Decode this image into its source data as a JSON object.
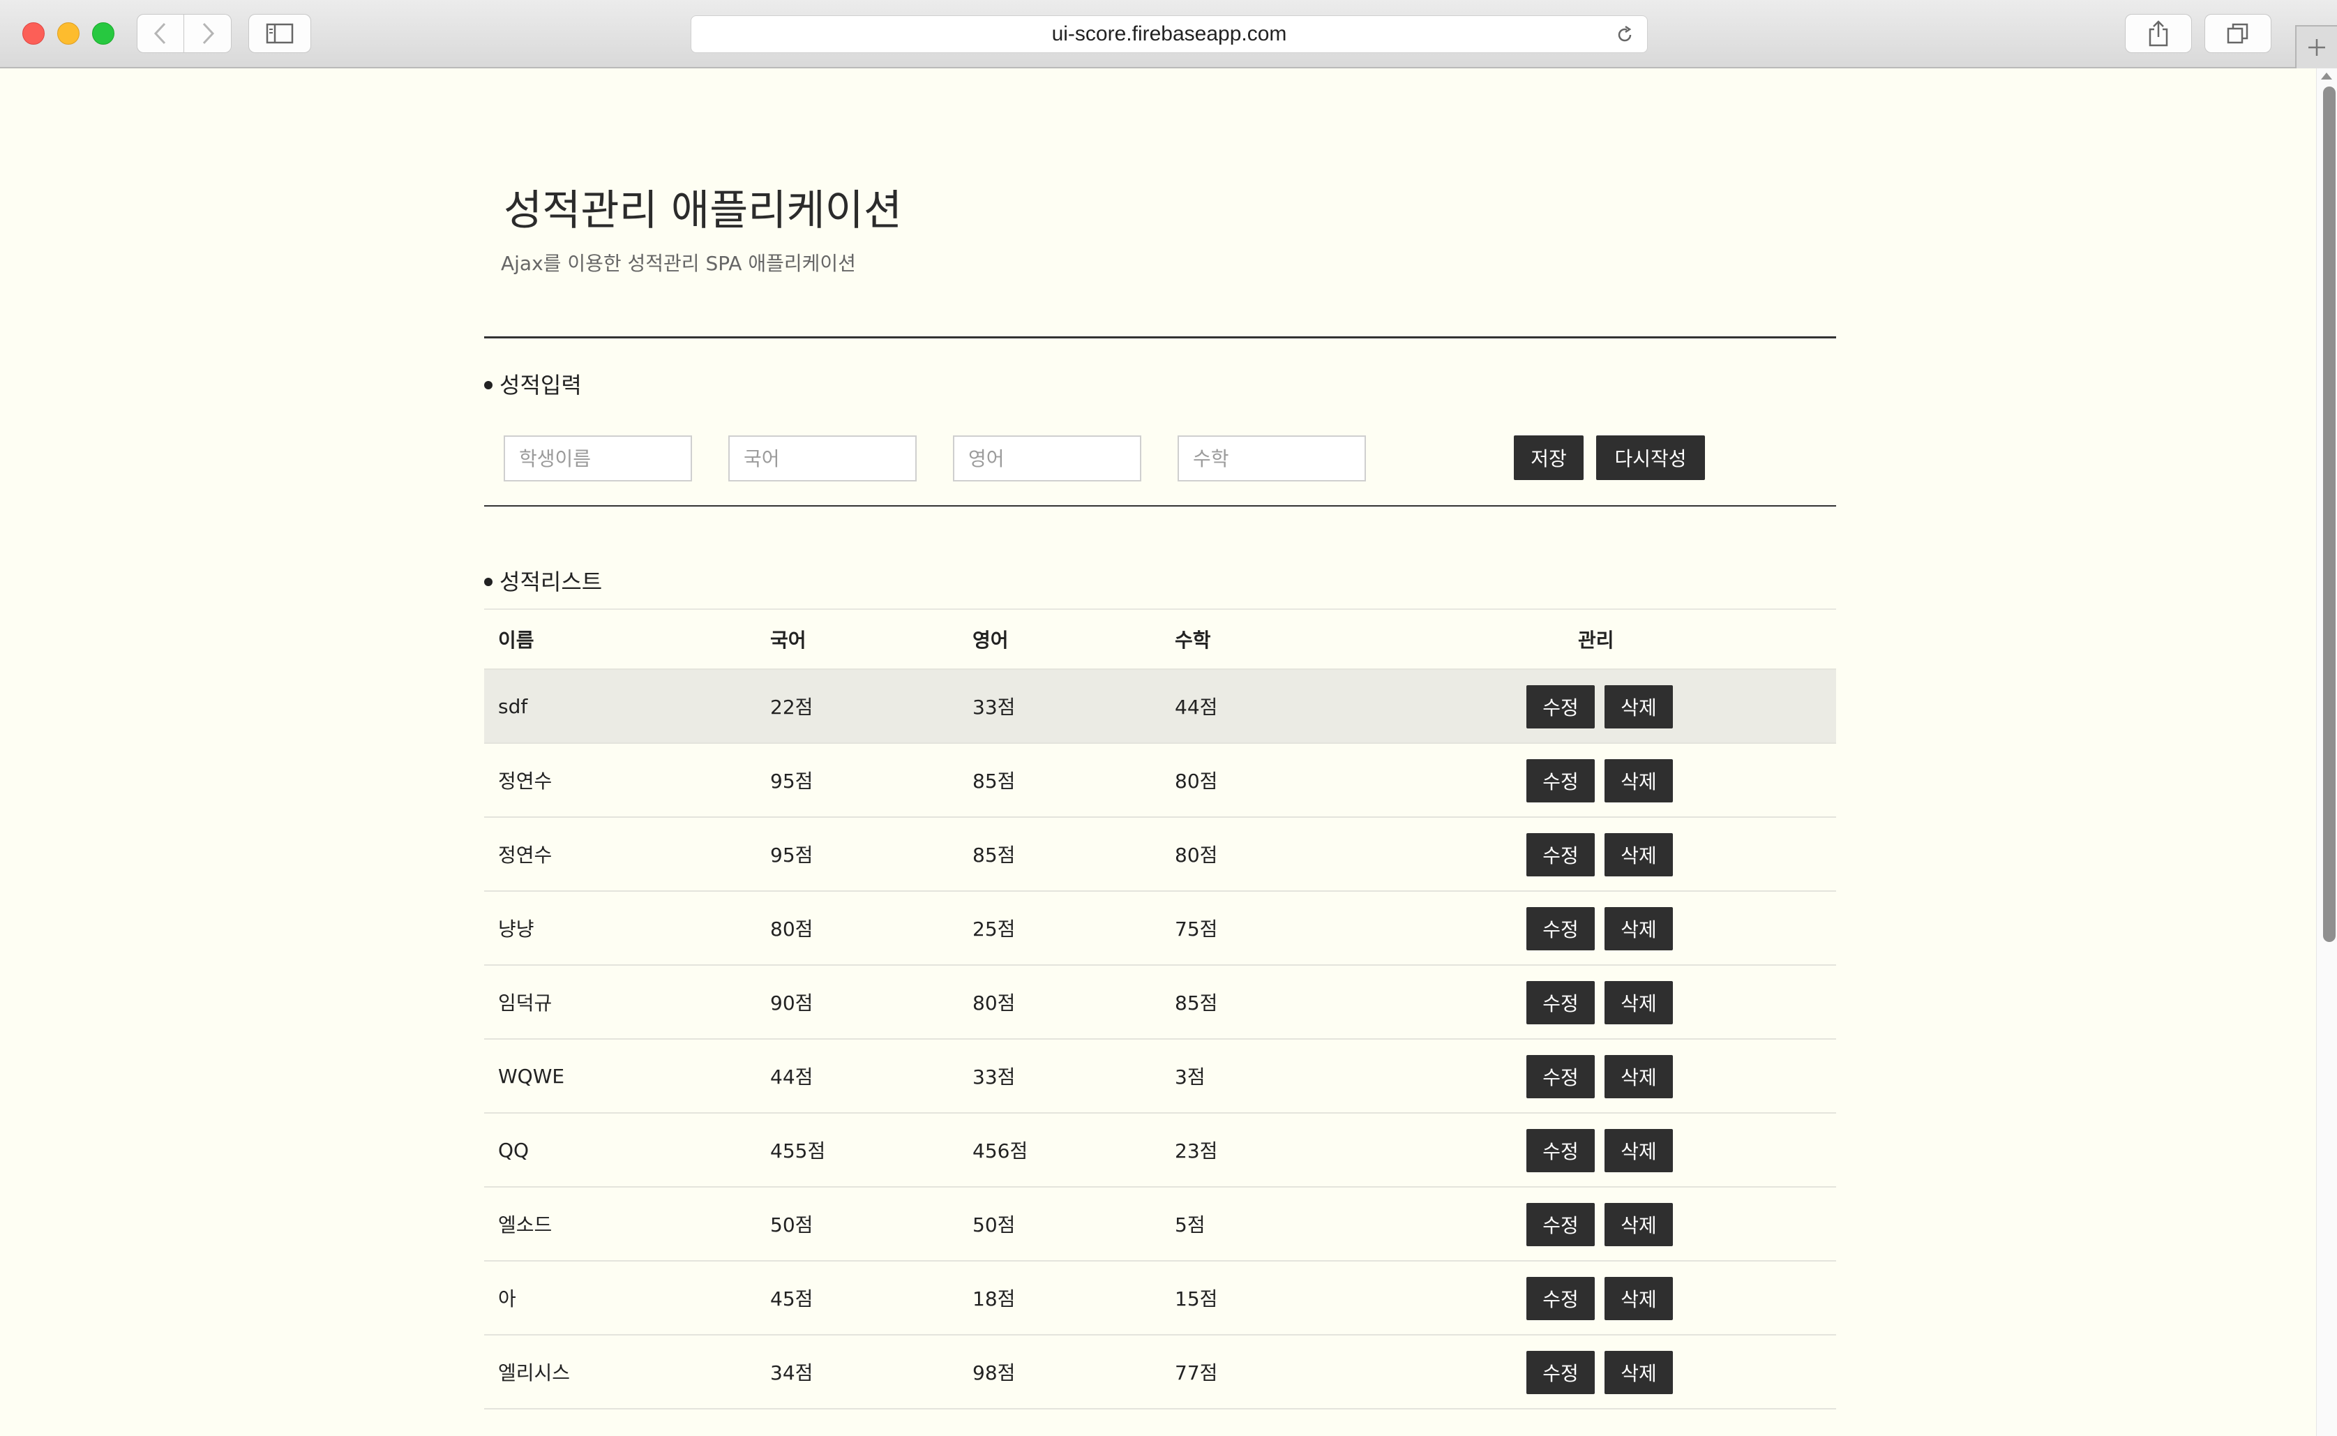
{
  "browser": {
    "url": "ui-score.firebaseapp.com",
    "icons": [
      "back-icon",
      "forward-icon",
      "sidebar-icon",
      "reload-icon",
      "share-icon",
      "tabs-icon",
      "add-tab-icon"
    ]
  },
  "header": {
    "title": "성적관리 애플리케이션",
    "subtitle": "Ajax를 이용한 성적관리 SPA 애플리케이션"
  },
  "input_section": {
    "title": "성적입력",
    "fields": {
      "name_placeholder": "학생이름",
      "korean_placeholder": "국어",
      "english_placeholder": "영어",
      "math_placeholder": "수학"
    },
    "save_label": "저장",
    "reset_label": "다시작성"
  },
  "list_section": {
    "title": "성적리스트",
    "columns": {
      "name": "이름",
      "korean": "국어",
      "english": "영어",
      "math": "수학",
      "manage": "관리"
    },
    "edit_label": "수정",
    "delete_label": "삭제",
    "rows": [
      {
        "name": "sdf",
        "korean": "22점",
        "english": "33점",
        "math": "44점"
      },
      {
        "name": "정연수",
        "korean": "95점",
        "english": "85점",
        "math": "80점"
      },
      {
        "name": "정연수",
        "korean": "95점",
        "english": "85점",
        "math": "80점"
      },
      {
        "name": "냥냥",
        "korean": "80점",
        "english": "25점",
        "math": "75점"
      },
      {
        "name": "임덕규",
        "korean": "90점",
        "english": "80점",
        "math": "85점"
      },
      {
        "name": "WQWE",
        "korean": "44점",
        "english": "33점",
        "math": "3점"
      },
      {
        "name": "QQ",
        "korean": "455점",
        "english": "456점",
        "math": "23점"
      },
      {
        "name": "엘소드",
        "korean": "50점",
        "english": "50점",
        "math": "5점"
      },
      {
        "name": "아",
        "korean": "45점",
        "english": "18점",
        "math": "15점"
      },
      {
        "name": "엘리시스",
        "korean": "34점",
        "english": "98점",
        "math": "77점"
      }
    ]
  }
}
